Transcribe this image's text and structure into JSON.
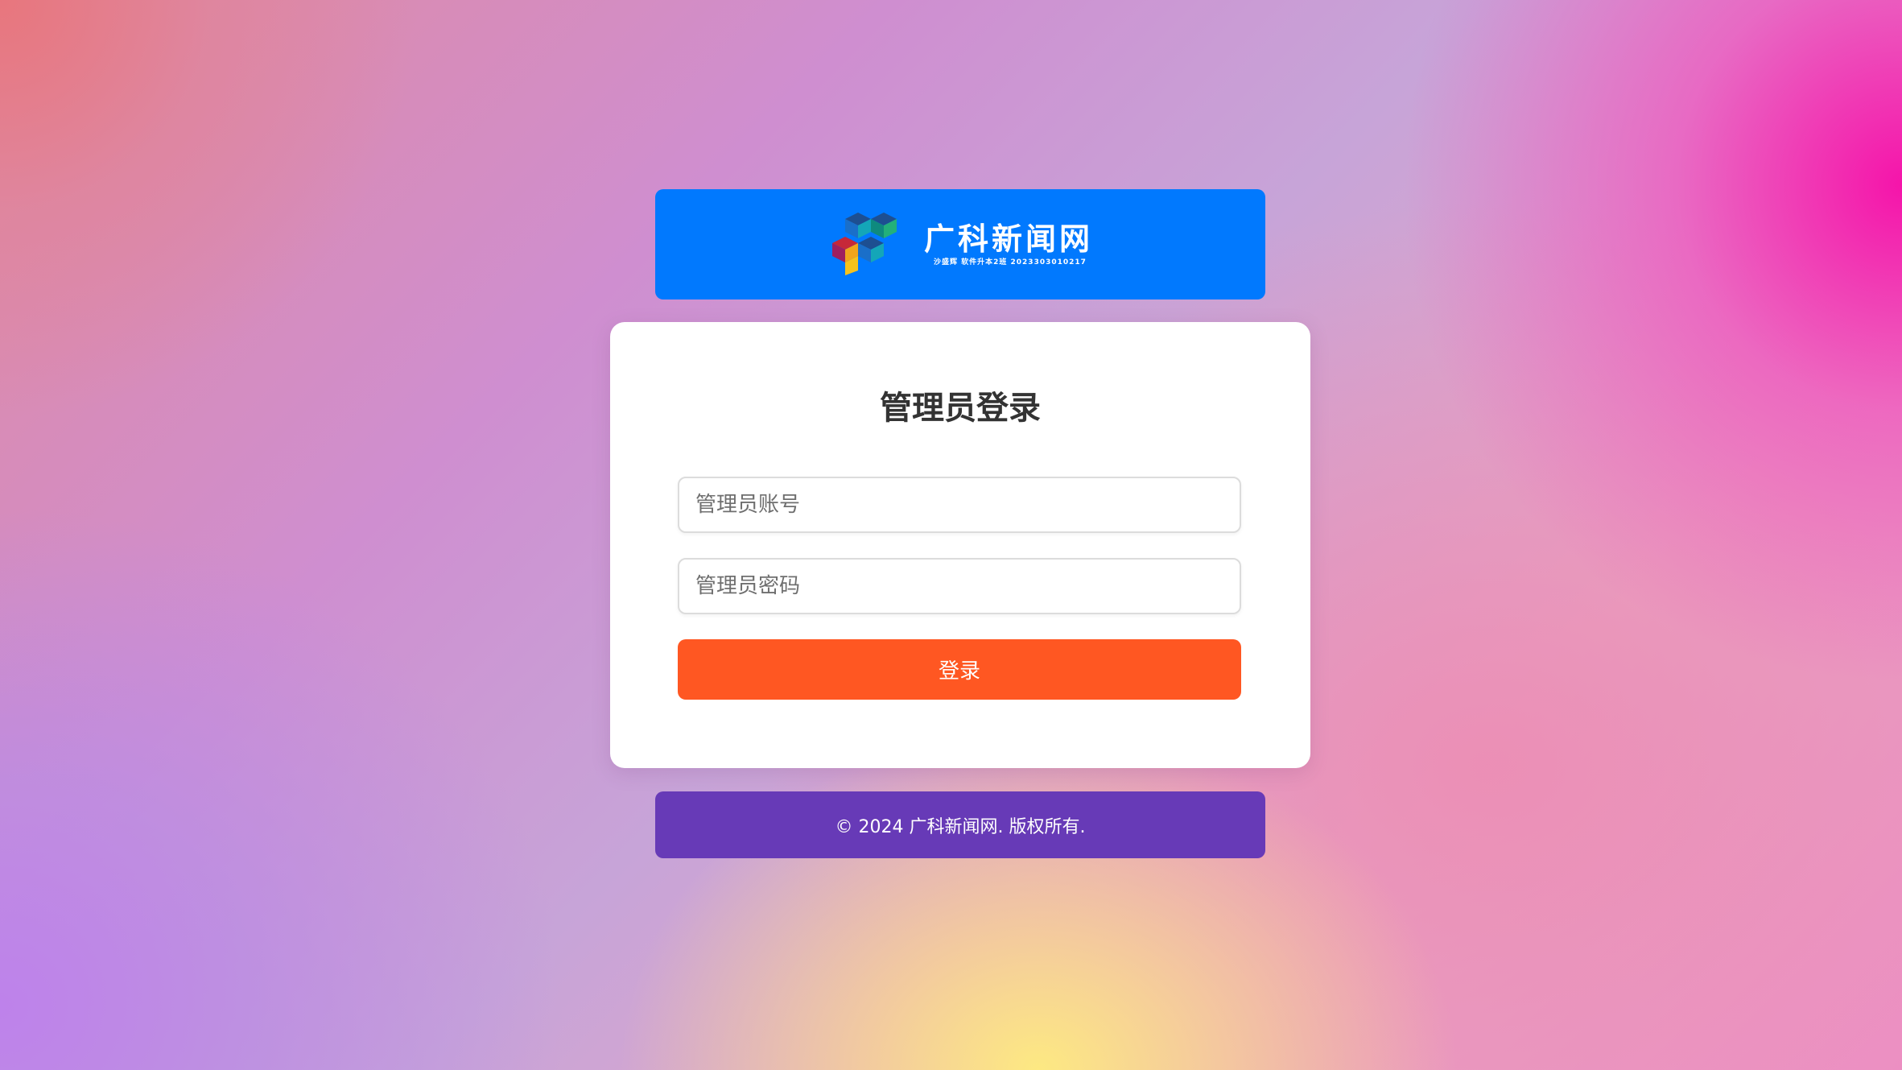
{
  "logo": {
    "title": "广科新闻网",
    "subtitle": "沙盛辉 软件升本2班 2023303010217",
    "banner_color": "#0179fe"
  },
  "login": {
    "title": "管理员登录",
    "account_placeholder": "管理员账号",
    "account_value": "",
    "password_placeholder": "管理员密码",
    "password_value": "",
    "submit_label": "登录",
    "submit_color": "#ff5722"
  },
  "footer": {
    "text": "© 2024 广科新闻网. 版权所有.",
    "color": "#673ab7"
  }
}
